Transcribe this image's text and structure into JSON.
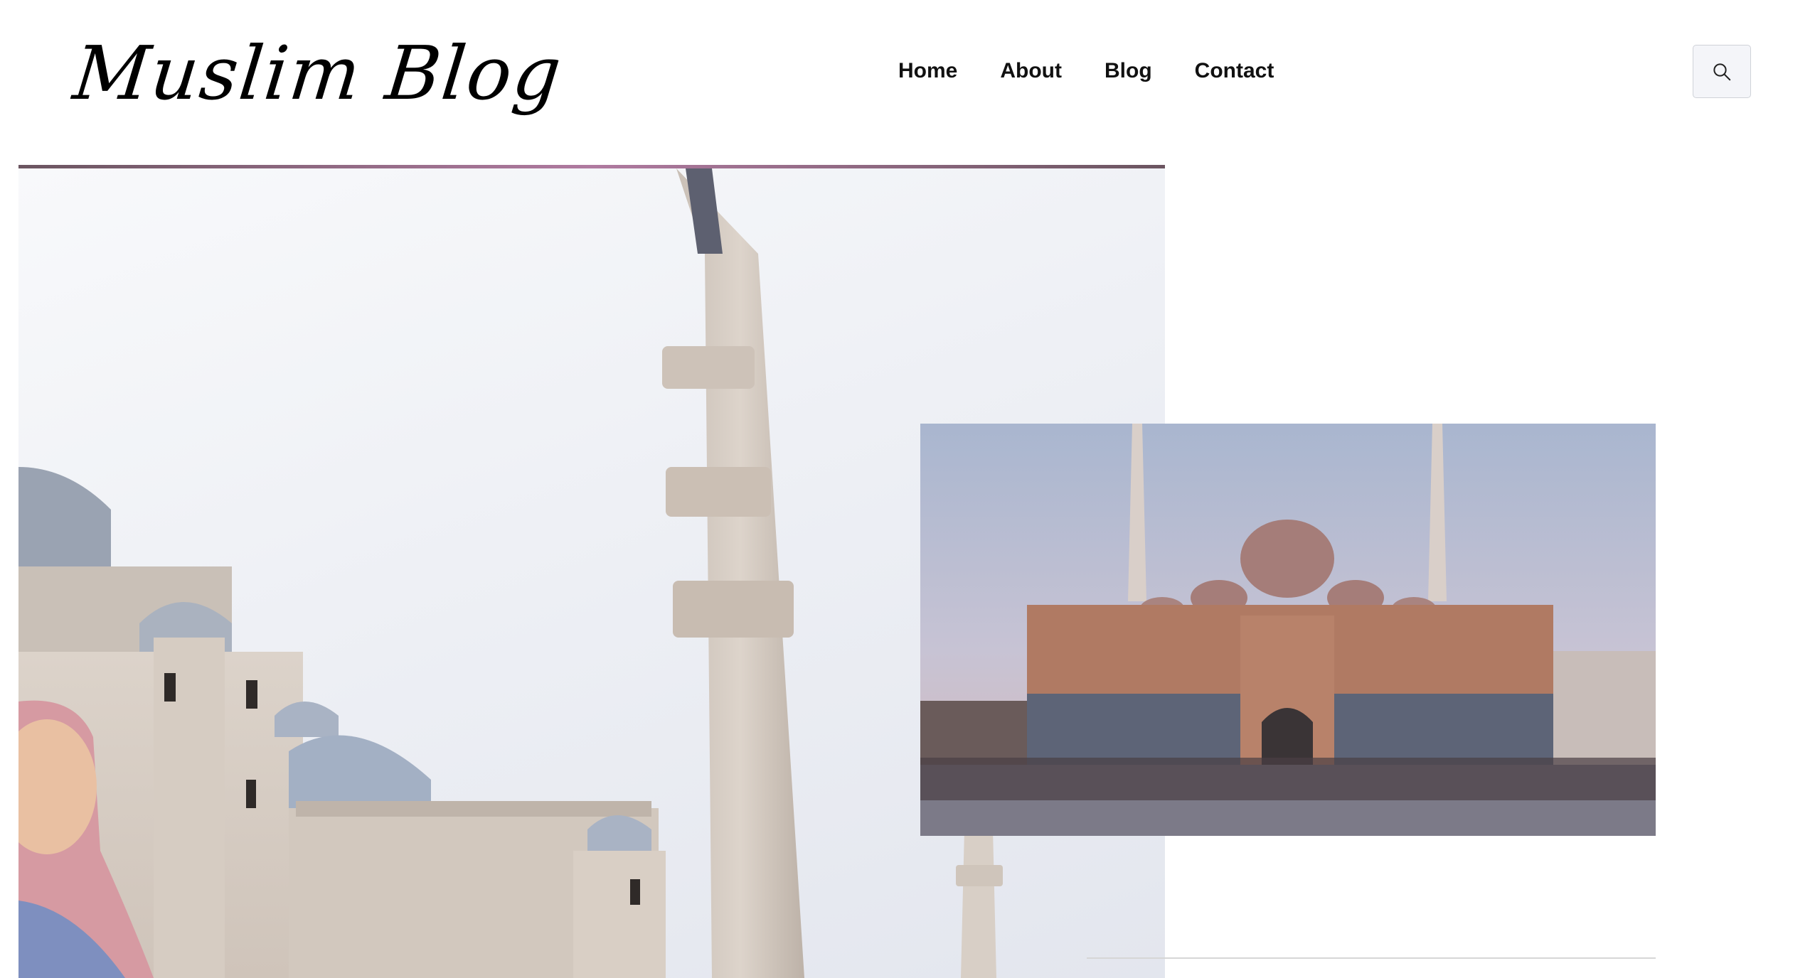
{
  "header": {
    "logo_text": "Muslim Blog",
    "nav": [
      {
        "label": "Home"
      },
      {
        "label": "About"
      },
      {
        "label": "Blog"
      },
      {
        "label": "Contact"
      }
    ],
    "search_icon": "search-icon"
  },
  "hero": {
    "main_image": "mosque-minaret-photo",
    "inset_image": "mosque-square-photo",
    "accent_color": "#b07aa0"
  }
}
